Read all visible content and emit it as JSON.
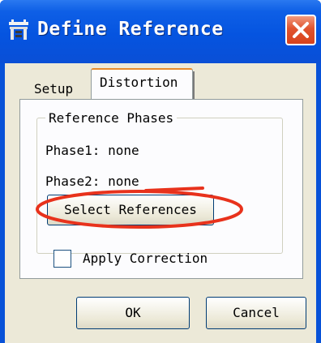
{
  "window": {
    "title": "Define Reference"
  },
  "icons": {
    "app": "app-icon",
    "close": "close-icon"
  },
  "tabs": [
    {
      "label": "Setup",
      "active": false
    },
    {
      "label": "Distortion",
      "active": true
    }
  ],
  "group": {
    "label": "Reference Phases",
    "phase1": "Phase1: none",
    "phase2": "Phase2: none",
    "select_button": "Select References"
  },
  "apply_correction": {
    "label": "Apply Correction",
    "checked": false
  },
  "buttons": {
    "ok": "OK",
    "cancel": "Cancel"
  },
  "colors": {
    "titlebar": "#0554e0",
    "close": "#e0532e",
    "dialog": "#ece9d8",
    "annotation": "#e8321c"
  }
}
